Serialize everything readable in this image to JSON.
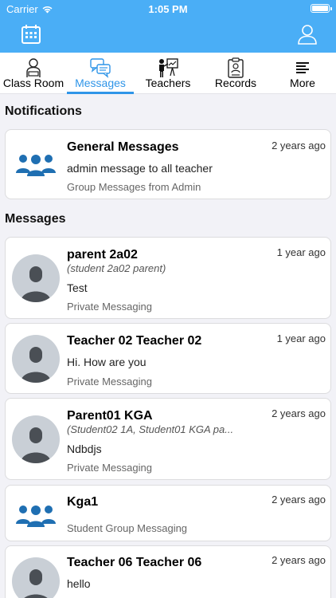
{
  "status_bar": {
    "carrier": "Carrier",
    "time": "1:05 PM"
  },
  "header": {
    "calendar_icon": "calendar-icon",
    "profile_icon": "profile-icon"
  },
  "tabs": [
    {
      "label": "Class Room",
      "icon": "classroom-icon",
      "active": false
    },
    {
      "label": "Messages",
      "icon": "messages-icon",
      "active": true
    },
    {
      "label": "Teachers",
      "icon": "teacher-icon",
      "active": false
    },
    {
      "label": "Records",
      "icon": "records-icon",
      "active": false
    },
    {
      "label": "More",
      "icon": "menu-icon",
      "active": false
    }
  ],
  "sections": {
    "notifications": "Notifications",
    "messages": "Messages"
  },
  "notifications": [
    {
      "name": "General Messages",
      "message": "admin message to all teacher",
      "type": "Group Messages from Admin",
      "time": "2 years ago",
      "icon": "group-icon"
    }
  ],
  "messages": [
    {
      "name": "parent 2a02",
      "subtitle": "(student 2a02 parent)",
      "message": "Test",
      "type": "Private Messaging",
      "time": "1 year ago",
      "icon": "avatar"
    },
    {
      "name": "Teacher 02 Teacher 02",
      "subtitle": "",
      "message": "Hi. How are you",
      "type": "Private Messaging",
      "time": "1 year ago",
      "icon": "avatar"
    },
    {
      "name": "Parent01 KGA",
      "subtitle": "(Student02 1A, Student01 KGA pa...",
      "message": "Ndbdjs",
      "type": "Private Messaging",
      "time": "2 years ago",
      "icon": "avatar"
    },
    {
      "name": "Kga1",
      "subtitle": "",
      "message": "",
      "type": "Student Group Messaging",
      "time": "2 years ago",
      "icon": "group-icon"
    },
    {
      "name": "Teacher 06 Teacher 06",
      "subtitle": "",
      "message": "hello",
      "type": "",
      "time": "2 years ago",
      "icon": "avatar"
    }
  ],
  "colors": {
    "header": "#4aaef6",
    "accent": "#2f95e8",
    "group_icon": "#1f6fb2"
  }
}
